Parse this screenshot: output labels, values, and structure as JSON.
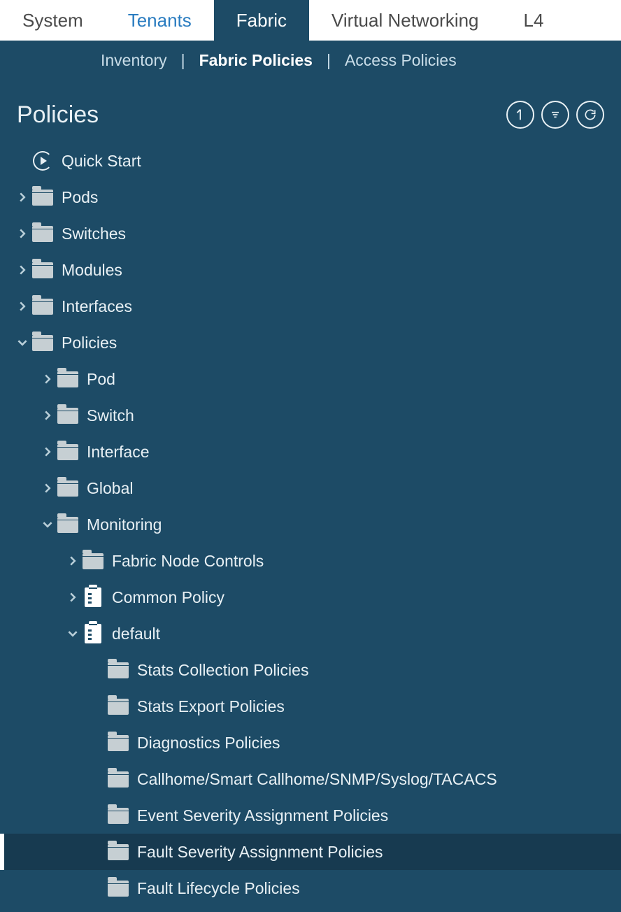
{
  "topnav": {
    "tabs": [
      {
        "label": "System"
      },
      {
        "label": "Tenants"
      },
      {
        "label": "Fabric"
      },
      {
        "label": "Virtual Networking"
      },
      {
        "label": "L4"
      }
    ]
  },
  "subnav": {
    "items": [
      {
        "label": "Inventory"
      },
      {
        "label": "Fabric Policies"
      },
      {
        "label": "Access Policies"
      }
    ]
  },
  "panel": {
    "title": "Policies"
  },
  "tree": {
    "quick_start": "Quick Start",
    "pods": "Pods",
    "switches": "Switches",
    "modules": "Modules",
    "interfaces": "Interfaces",
    "policies": "Policies",
    "pod": "Pod",
    "switch": "Switch",
    "interface": "Interface",
    "global": "Global",
    "monitoring": "Monitoring",
    "fabric_node_controls": "Fabric Node Controls",
    "common_policy": "Common Policy",
    "default": "default",
    "stats_collection": "Stats Collection Policies",
    "stats_export": "Stats Export Policies",
    "diagnostics": "Diagnostics Policies",
    "callhome": "Callhome/Smart Callhome/SNMP/Syslog/TACACS",
    "event_severity": "Event Severity Assignment Policies",
    "fault_severity": "Fault Severity Assignment Policies",
    "fault_lifecycle": "Fault Lifecycle Policies"
  }
}
